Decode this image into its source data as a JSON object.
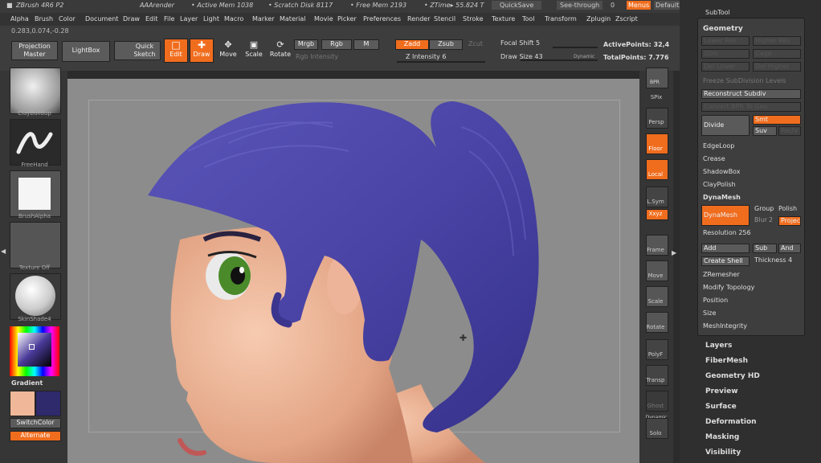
{
  "titlebar": {
    "app": "ZBrush 4R6 P2",
    "render": "AAArender",
    "active_mem": "• Active Mem 1038",
    "scratch": "• Scratch Disk 8117",
    "free_mem": "• Free Mem 2193",
    "ztime": "• ZTime▸ 55.824 T",
    "quicksave": "QuickSave",
    "seethrough": "See-through",
    "seethrough_val": "0",
    "menus": "Menus",
    "script": "DefaultZScript"
  },
  "menus": [
    "Alpha",
    "Brush",
    "Color",
    "Document",
    "Draw",
    "Edit",
    "File",
    "Layer",
    "Light",
    "Macro",
    "Marker",
    "Material",
    "Movie",
    "Picker",
    "Preferences",
    "Render",
    "Stencil",
    "Stroke",
    "Texture",
    "Tool",
    "Transform",
    "Zplugin",
    "Zscript"
  ],
  "coords": "0.283,0.074,-0.28",
  "toolbar": {
    "projection_master": "Projection Master",
    "lightbox": "LightBox",
    "quick_sketch": "Quick Sketch",
    "edit": "Edit",
    "draw": "Draw",
    "move": "Move",
    "scale": "Scale",
    "rotate": "Rotate",
    "mrgb": "Mrgb",
    "rgb": "Rgb",
    "m": "M",
    "zadd": "Zadd",
    "zsub": "Zsub",
    "zcut": "Zcut",
    "rgb_intensity": "Rgb Intensity",
    "z_intensity": "Z Intensity 6",
    "focal_shift": "Focal Shift 5",
    "draw_size": "Draw Size 43",
    "dynamic": "Dynamic",
    "active_points": "ActivePoints: 32,4",
    "total_points": "TotalPoints: 7.776"
  },
  "left_shelf": {
    "brush": "ClayBuildup",
    "stroke": "FreeHand",
    "alpha": "BrushAlpha",
    "texture": "Texture Off",
    "material": "SkinShade4",
    "gradient": "Gradient",
    "switch_color": "SwitchColor",
    "alternate": "Alternate"
  },
  "right_shelf": {
    "bpr": "BPR",
    "spix": "SPix",
    "persp": "Persp",
    "floor": "Floor",
    "local": "Local",
    "lsym": "L.Sym",
    "xyz": "Xxyz",
    "frame": "Frame",
    "move": "Move",
    "scale": "Scale",
    "rotate": "Rotate",
    "polyf": "PolyF",
    "transp": "Transp",
    "ghost": "Ghost",
    "dynamic": "Dynamic",
    "solo": "Solo"
  },
  "subtool_panel": {
    "top": "SubTool",
    "geometry": "Geometry",
    "lower_res": "Lower Res",
    "higher_res": "Higher Res",
    "sdiv": "SDiv",
    "cage": "Cage",
    "del_lower": "Del Lower",
    "del_higher": "Del Higher",
    "freeze": "Freeze SubDivision Levels",
    "reconstruct": "Reconstruct Subdiv",
    "convert_bpr": "Convert BPR To Geo",
    "divide": "Divide",
    "smt": "Smt",
    "suv": "Suv",
    "reuv": "ReUV",
    "edgeloop": "EdgeLoop",
    "crease": "Crease",
    "shadowbox": "ShadowBox",
    "claypolish": "ClayPolish",
    "dynamesh_header": "DynaMesh",
    "dynamesh_btn": "DynaMesh",
    "group": "Group",
    "polish": "Polish",
    "blur": "Blur",
    "blur_val": "2",
    "project": "Project",
    "resolution": "Resolution 256",
    "add": "Add",
    "sub": "Sub",
    "and": "And",
    "create_shell": "Create Shell",
    "thickness": "Thickness 4",
    "zremesher": "ZRemesher",
    "modify_topology": "Modify Topology",
    "position": "Position",
    "size": "Size",
    "meshintegrity": "MeshIntegrity"
  },
  "right_sections": [
    "Layers",
    "FiberMesh",
    "Geometry HD",
    "Preview",
    "Surface",
    "Deformation",
    "Masking",
    "Visibility"
  ]
}
